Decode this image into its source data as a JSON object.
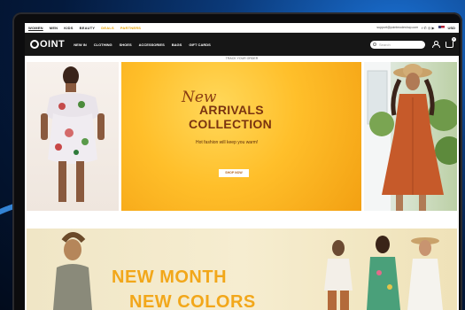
{
  "topbar": {
    "categories": [
      "WOMEN",
      "MEN",
      "KIDS",
      "BEAUTY",
      "DEALS",
      "PARTNERS"
    ],
    "email": "support@pointmodeshop.com",
    "social": "f ✆ ◎ ▶",
    "currency": "USD"
  },
  "navbar": {
    "logo": "OINT",
    "items": [
      "NEW IN",
      "CLOTHING",
      "SHOES",
      "ACCESSORIES",
      "BAGS",
      "GIFT CARDS"
    ],
    "search_placeholder": "Search",
    "cart_count": "0"
  },
  "track_text": "TRACK YOUR ORDER",
  "hero": {
    "script": "New",
    "line1": "ARRIVALS",
    "line2": "COLLECTION",
    "tagline": "Hot fashion will keep you warm!",
    "button": "SHOP NOW"
  },
  "banner2": {
    "line1": "NEW MONTH",
    "line2": "NEW COLORS"
  },
  "colors": {
    "accent": "#f2a71a",
    "hero_bg": "#ffbf2a",
    "nav_bg": "#161616"
  }
}
